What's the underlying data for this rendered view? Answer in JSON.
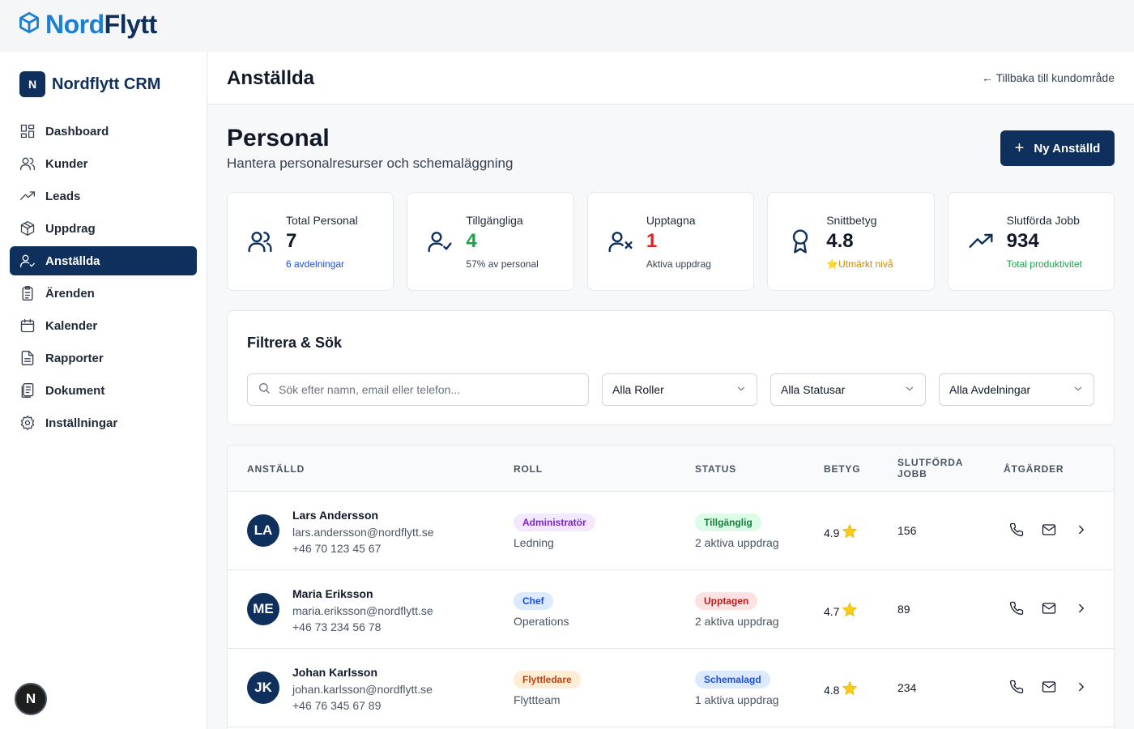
{
  "brand": {
    "part1": "Nord",
    "part2": "Flytt"
  },
  "sidebar": {
    "logo_letter": "N",
    "title": "Nordflytt CRM",
    "items": [
      {
        "label": "Dashboard",
        "icon": "dashboard-icon",
        "active": false
      },
      {
        "label": "Kunder",
        "icon": "users-icon",
        "active": false
      },
      {
        "label": "Leads",
        "icon": "trending-up-icon",
        "active": false
      },
      {
        "label": "Uppdrag",
        "icon": "package-icon",
        "active": false
      },
      {
        "label": "Anställda",
        "icon": "user-check-icon",
        "active": true
      },
      {
        "label": "Ärenden",
        "icon": "clipboard-icon",
        "active": false
      },
      {
        "label": "Kalender",
        "icon": "calendar-icon",
        "active": false
      },
      {
        "label": "Rapporter",
        "icon": "file-text-icon",
        "active": false
      },
      {
        "label": "Dokument",
        "icon": "documents-icon",
        "active": false
      },
      {
        "label": "Inställningar",
        "icon": "gear-icon",
        "active": false
      }
    ],
    "bottom_badge": "N"
  },
  "header": {
    "title": "Anställda",
    "back_link": "← Tillbaka till kundområde"
  },
  "page": {
    "title": "Personal",
    "subtitle": "Hantera personalresurser och schemaläggning",
    "new_button": "Ny Anställd"
  },
  "stats": [
    {
      "label": "Total Personal",
      "value": "7",
      "note": "6 avdelningar",
      "icon": "users-icon",
      "value_color": "#111827",
      "note_color": "#1d4ed8"
    },
    {
      "label": "Tillgängliga",
      "value": "4",
      "note": "57% av personal",
      "icon": "user-check-icon",
      "value_color": "#16a34a",
      "note_color": "#374151"
    },
    {
      "label": "Upptagna",
      "value": "1",
      "note": "Aktiva uppdrag",
      "icon": "user-x-icon",
      "value_color": "#dc2626",
      "note_color": "#374151"
    },
    {
      "label": "Snittbetyg",
      "value": "4.8",
      "note": "⭐Utmärkt nivå",
      "icon": "award-icon",
      "value_color": "#111827",
      "note_color": "#ca8a04"
    },
    {
      "label": "Slutförda Jobb",
      "value": "934",
      "note": "Total produktivitet",
      "icon": "trending-up-icon",
      "value_color": "#111827",
      "note_color": "#16a34a"
    }
  ],
  "filter": {
    "title": "Filtrera & Sök",
    "search_placeholder": "Sök efter namn, email eller telefon...",
    "role_select": "Alla Roller",
    "status_select": "Alla Statusar",
    "dept_select": "Alla Avdelningar"
  },
  "table": {
    "headers": {
      "employee": "ANSTÄLLD",
      "role": "ROLL",
      "status": "STATUS",
      "rating": "BETYG",
      "jobs_line1": "SLUTFÖRDA",
      "jobs_line2": "JOBB",
      "actions": "ÅTGÄRDER"
    },
    "rows": [
      {
        "initials": "LA",
        "name": "Lars Andersson",
        "email": "lars.andersson@nordflytt.se",
        "phone": "+46 70 123 45 67",
        "role": "Administratör",
        "role_bg": "#f3e8ff",
        "role_fg": "#7e22ce",
        "department": "Ledning",
        "status": "Tillgänglig",
        "status_bg": "#dcfce7",
        "status_fg": "#15803d",
        "active_jobs": "2 aktiva uppdrag",
        "rating": "4.9",
        "completed": "156"
      },
      {
        "initials": "ME",
        "name": "Maria Eriksson",
        "email": "maria.eriksson@nordflytt.se",
        "phone": "+46 73 234 56 78",
        "role": "Chef",
        "role_bg": "#dbeafe",
        "role_fg": "#1d4ed8",
        "department": "Operations",
        "status": "Upptagen",
        "status_bg": "#fee2e2",
        "status_fg": "#b91c1c",
        "active_jobs": "2 aktiva uppdrag",
        "rating": "4.7",
        "completed": "89"
      },
      {
        "initials": "JK",
        "name": "Johan Karlsson",
        "email": "johan.karlsson@nordflytt.se",
        "phone": "+46 76 345 67 89",
        "role": "Flyttledare",
        "role_bg": "#ffedd5",
        "role_fg": "#c2410c",
        "department": "Flyttteam",
        "status": "Schemalagd",
        "status_bg": "#dbeafe",
        "status_fg": "#1d4ed8",
        "active_jobs": "1 aktiva uppdrag",
        "rating": "4.8",
        "completed": "234"
      }
    ]
  },
  "colors": {
    "primary": "#0f2f5c",
    "brand_blue": "#1d7fd3",
    "star": "#facc15"
  }
}
